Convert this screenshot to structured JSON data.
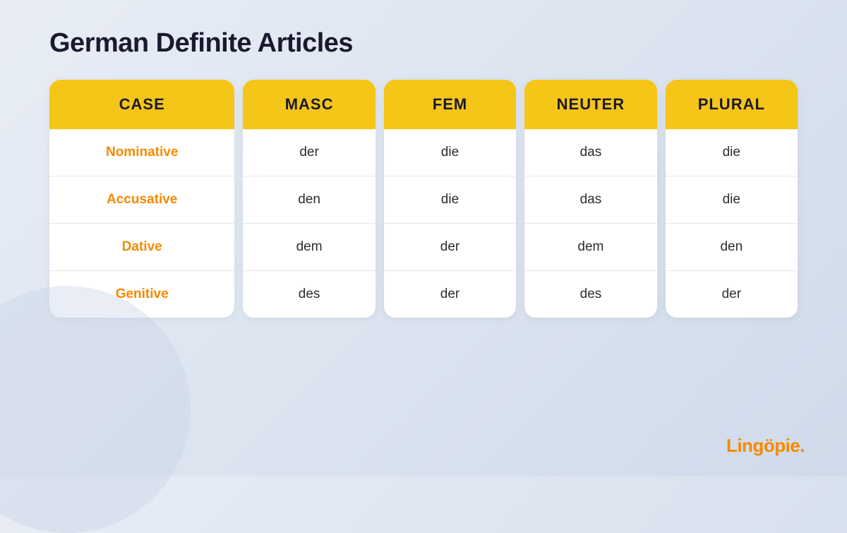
{
  "page": {
    "title": "German Definite Articles",
    "branding": "Lingöpie."
  },
  "columns": [
    {
      "id": "case",
      "header": "CASE",
      "cells": [
        "Nominative",
        "Accusative",
        "Dative",
        "Genitive"
      ],
      "type": "case"
    },
    {
      "id": "masc",
      "header": "MASC",
      "cells": [
        "der",
        "den",
        "dem",
        "des"
      ],
      "type": "value"
    },
    {
      "id": "fem",
      "header": "FEM",
      "cells": [
        "die",
        "die",
        "der",
        "der"
      ],
      "type": "value"
    },
    {
      "id": "neuter",
      "header": "NEUTER",
      "cells": [
        "das",
        "das",
        "dem",
        "des"
      ],
      "type": "value"
    },
    {
      "id": "plural",
      "header": "PLURAL",
      "cells": [
        "die",
        "die",
        "den",
        "der"
      ],
      "type": "value"
    }
  ]
}
